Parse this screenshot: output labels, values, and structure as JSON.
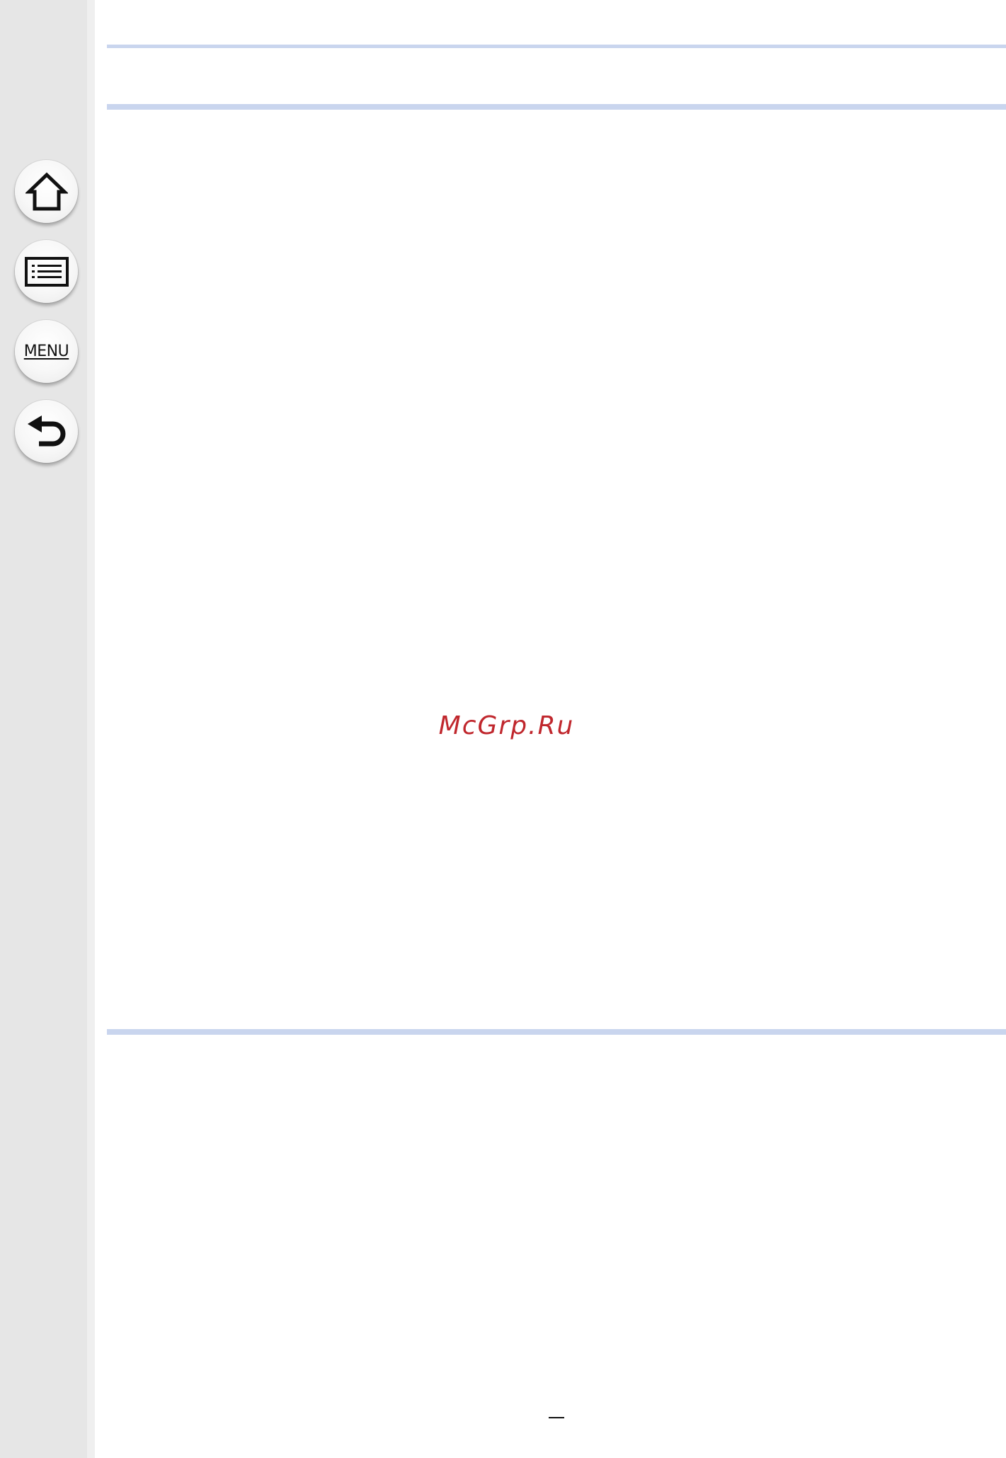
{
  "sidebar": {
    "buttons": [
      {
        "name": "home-button",
        "icon": "home-icon"
      },
      {
        "name": "contents-button",
        "icon": "list-icon"
      },
      {
        "name": "menu-button",
        "label": "MENU"
      },
      {
        "name": "back-button",
        "icon": "return-arrow-icon"
      }
    ]
  },
  "watermark": {
    "text": "McGrp.Ru"
  },
  "colors": {
    "rule": "#c9d5ee",
    "watermark": "#c0272d",
    "sidebar": "#e6e6e6"
  }
}
